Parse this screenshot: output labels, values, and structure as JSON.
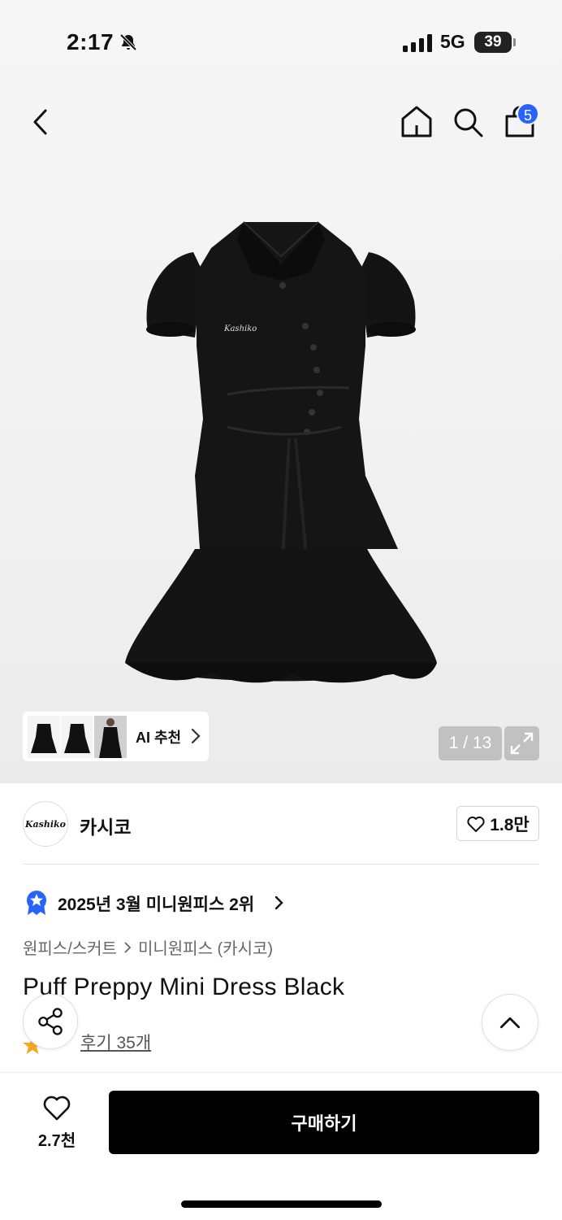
{
  "status_bar": {
    "time": "2:17",
    "network": "5G",
    "battery": "39"
  },
  "nav": {
    "cart_count": "5"
  },
  "gallery": {
    "ai_label": "AI 추천",
    "counter": "1 / 13"
  },
  "brand": {
    "logo_text": "Kashiko",
    "name": "카시코",
    "likes": "1.8만"
  },
  "ranking": {
    "text": "2025년 3월 미니원피스 2위"
  },
  "breadcrumb": {
    "category": "원피스/스커트",
    "subcategory": "미니원피스 (카시코)"
  },
  "product": {
    "title": "Puff Preppy Mini Dress Black",
    "reviews": "후기 35개"
  },
  "bottom_bar": {
    "wish_count": "2.7천",
    "buy_label": "구매하기"
  },
  "colors": {
    "accent": "#2764ff",
    "star": "#f5a623",
    "primary_button": "#000000"
  }
}
